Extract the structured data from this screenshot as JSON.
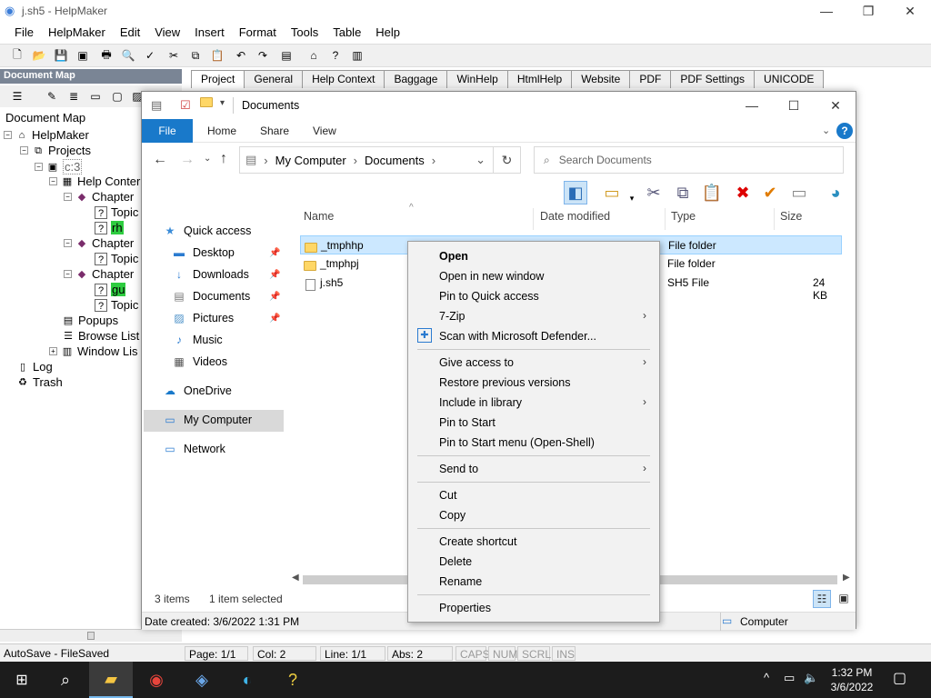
{
  "app": {
    "title": "j.sh5 - HelpMaker",
    "menu": [
      "File",
      "HelpMaker",
      "Edit",
      "View",
      "Insert",
      "Format",
      "Tools",
      "Table",
      "Help"
    ],
    "doc_map_header": "Document Map",
    "doc_map_title": "Document Map",
    "tabs": [
      "Project",
      "General",
      "Help Context",
      "Baggage",
      "WinHelp",
      "HtmlHelp",
      "Website",
      "PDF",
      "PDF Settings",
      "UNICODE"
    ],
    "tree": {
      "root": "HelpMaker",
      "projects": "Projects",
      "project_node": "c:3",
      "help_contents": "Help Conter",
      "chapter": "Chapter",
      "topic": "Topic",
      "rh": "rh",
      "gu": "gu",
      "popups": "Popups",
      "browse_list": "Browse List",
      "window_list": "Window Lis",
      "log": "Log",
      "trash": "Trash"
    },
    "status": {
      "autosave": "AutoSave - FileSaved",
      "page": "Page: 1/1",
      "col": "Col: 2",
      "line": "Line: 1/1",
      "abs": "Abs: 2",
      "caps": "CAPS",
      "num": "NUM",
      "scrl": "SCRL",
      "ins": "INS"
    }
  },
  "explorer": {
    "title": "Documents",
    "ribbon": {
      "file": "File",
      "home": "Home",
      "share": "Share",
      "view": "View"
    },
    "address": [
      "My Computer",
      "Documents"
    ],
    "search_placeholder": "Search Documents",
    "nav": {
      "quick_access": "Quick access",
      "desktop": "Desktop",
      "downloads": "Downloads",
      "documents": "Documents",
      "pictures": "Pictures",
      "music": "Music",
      "videos": "Videos",
      "onedrive": "OneDrive",
      "my_computer": "My Computer",
      "network": "Network"
    },
    "columns": {
      "name": "Name",
      "date": "Date modified",
      "type": "Type",
      "size": "Size"
    },
    "files": [
      {
        "name": "_tmphhp",
        "type": "File folder",
        "size": ""
      },
      {
        "name": "_tmphpj",
        "type": "File folder",
        "size": ""
      },
      {
        "name": "j.sh5",
        "type": "SH5 File",
        "size": "24 KB"
      }
    ],
    "status": {
      "items": "3 items",
      "selected": "1 item selected"
    },
    "details": {
      "date_created": "Date created: 3/6/2022 1:31 PM",
      "location": "Computer"
    }
  },
  "context_menu": {
    "open": "Open",
    "open_new_window": "Open in new window",
    "pin_quick_access": "Pin to Quick access",
    "seven_zip": "7-Zip",
    "scan_defender": "Scan with Microsoft Defender...",
    "give_access": "Give access to",
    "restore_versions": "Restore previous versions",
    "include_library": "Include in library",
    "pin_start": "Pin to Start",
    "pin_start_menu": "Pin to Start menu (Open-Shell)",
    "send_to": "Send to",
    "cut": "Cut",
    "copy": "Copy",
    "create_shortcut": "Create shortcut",
    "delete": "Delete",
    "rename": "Rename",
    "properties": "Properties"
  },
  "taskbar": {
    "time": "1:32 PM",
    "date": "3/6/2022"
  },
  "colors": {
    "accent": "#1979ca",
    "selection": "#cce8ff",
    "tree_highlight": "#2ecc40",
    "taskbar": "#1c1c1c"
  }
}
